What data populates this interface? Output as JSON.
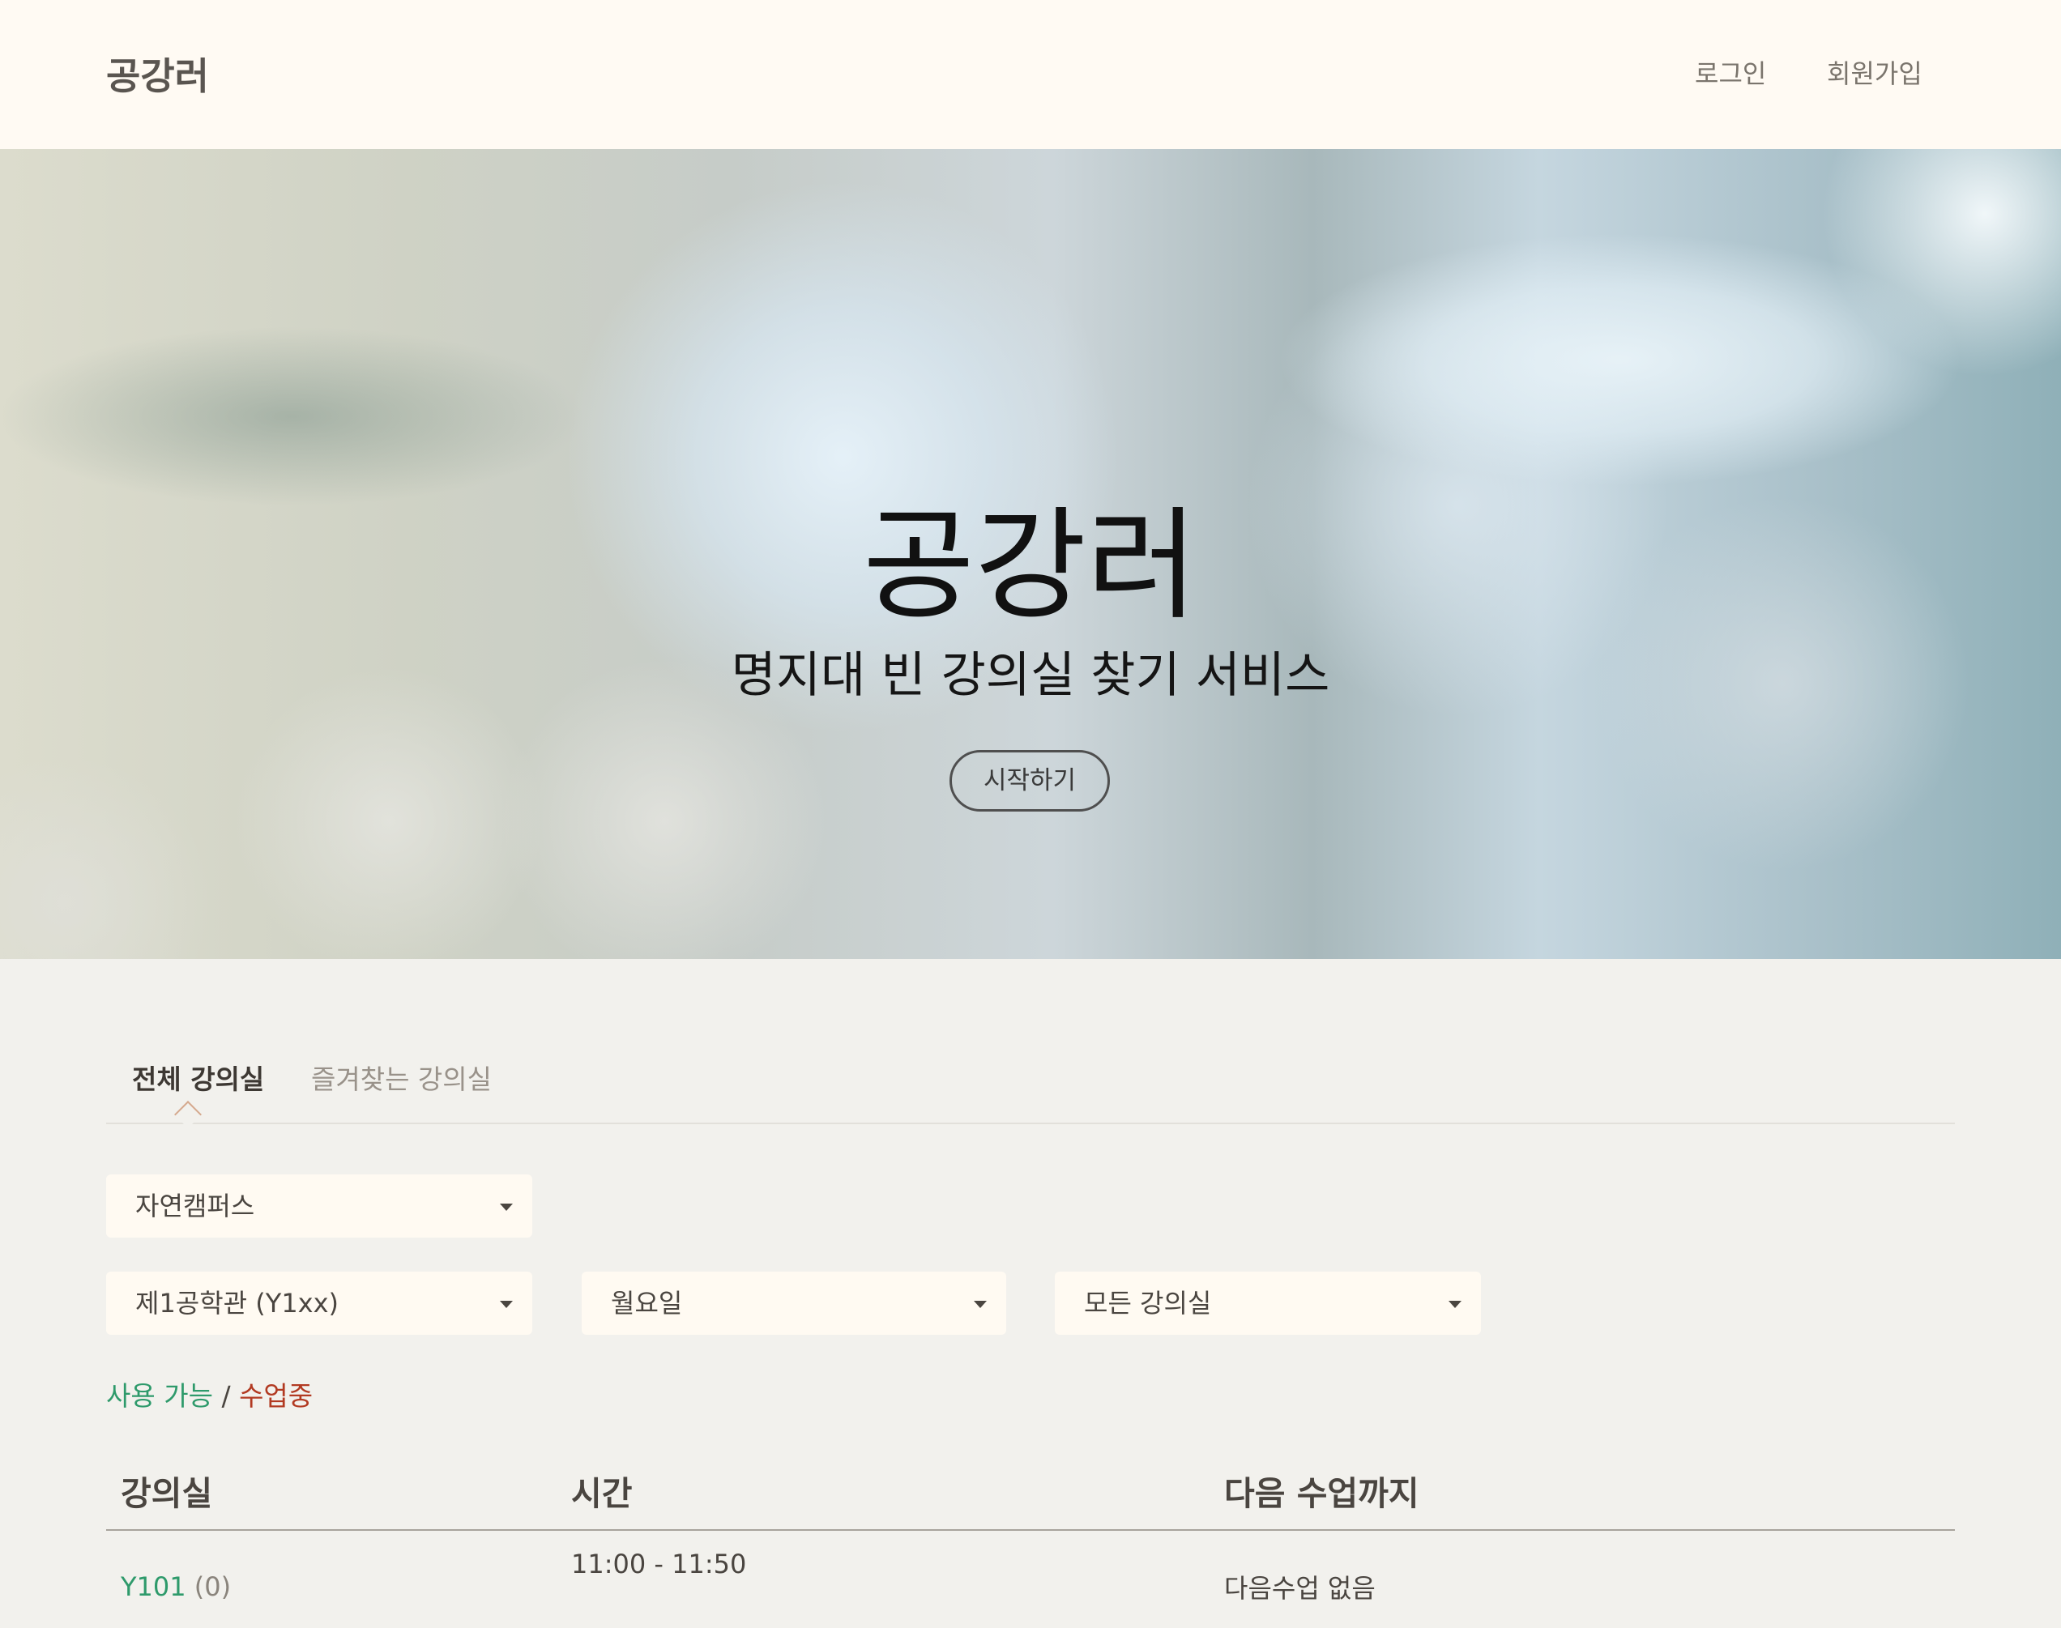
{
  "navbar": {
    "brand": "공강러",
    "login": "로그인",
    "signup": "회원가입"
  },
  "hero": {
    "title": "공강러",
    "subtitle": "명지대 빈 강의실 찾기 서비스",
    "button": "시작하기"
  },
  "tabs": [
    {
      "label": "전체 강의실",
      "active": true
    },
    {
      "label": "즐겨찾는 강의실",
      "active": false
    }
  ],
  "filters": {
    "campus": "자연캠퍼스",
    "building": "제1공학관 (Y1xx)",
    "day": "월요일",
    "room": "모든 강의실"
  },
  "legend": {
    "available": "사용 가능",
    "separator": "/",
    "in_class": "수업중"
  },
  "table": {
    "headers": {
      "room": "강의실",
      "time": "시간",
      "next": "다음 수업까지"
    },
    "rows": [
      {
        "room": "Y101",
        "count": "(0)",
        "time": "11:00 - 11:50",
        "next": "다음수업 없음"
      }
    ]
  },
  "colors": {
    "available": "#2e9a6b",
    "in_class": "#b23a22",
    "navbar_bg": "#fffaf3",
    "page_bg": "#f2f1ed"
  }
}
